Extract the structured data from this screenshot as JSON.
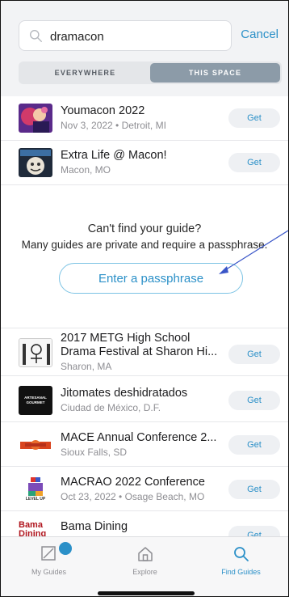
{
  "search": {
    "value": "dramacon",
    "cancel_label": "Cancel"
  },
  "segment": {
    "options": [
      "EVERYWHERE",
      "THIS SPACE"
    ],
    "selected": "THIS SPACE"
  },
  "results_top": [
    {
      "title": "Youmacon 2022",
      "subtitle": "Nov 3, 2022 • Detroit, MI",
      "action": "Get"
    },
    {
      "title": "Extra Life @ Macon!",
      "subtitle": "Macon, MO",
      "action": "Get"
    }
  ],
  "empty_state": {
    "title": "Can't find your guide?",
    "subtitle": "Many guides are private and require a passphrase.",
    "button_label": "Enter a passphrase"
  },
  "results_bottom": [
    {
      "title_line1": "2017 METG High School",
      "title_line2": "Drama Festival at Sharon Hi...",
      "subtitle": "Sharon, MA",
      "action": "Get"
    },
    {
      "title": "Jitomates deshidratados",
      "subtitle": "Ciudad de México, D.F.",
      "action": "Get",
      "thumb_text": "ARTESANAL GOURMET"
    },
    {
      "title": "MACE Annual Conference 2...",
      "subtitle": "Sioux Falls, SD",
      "action": "Get"
    },
    {
      "title": "MACRAO 2022 Conference",
      "subtitle": "Oct 23, 2022 • Osage Beach, MO",
      "action": "Get",
      "thumb_text": "LEVEL UP"
    },
    {
      "title": "Bama Dining",
      "action": "Get",
      "thumb_text": "Bama Dining"
    }
  ],
  "tabs": [
    {
      "label": "My Guides",
      "icon": "my-guides-icon"
    },
    {
      "label": "Explore",
      "icon": "home-icon"
    },
    {
      "label": "Find Guides",
      "icon": "search-icon"
    }
  ],
  "colors": {
    "accent": "#2b90c8",
    "segment_active": "#8c9ba8",
    "annotation_arrow": "#3a56c8"
  }
}
